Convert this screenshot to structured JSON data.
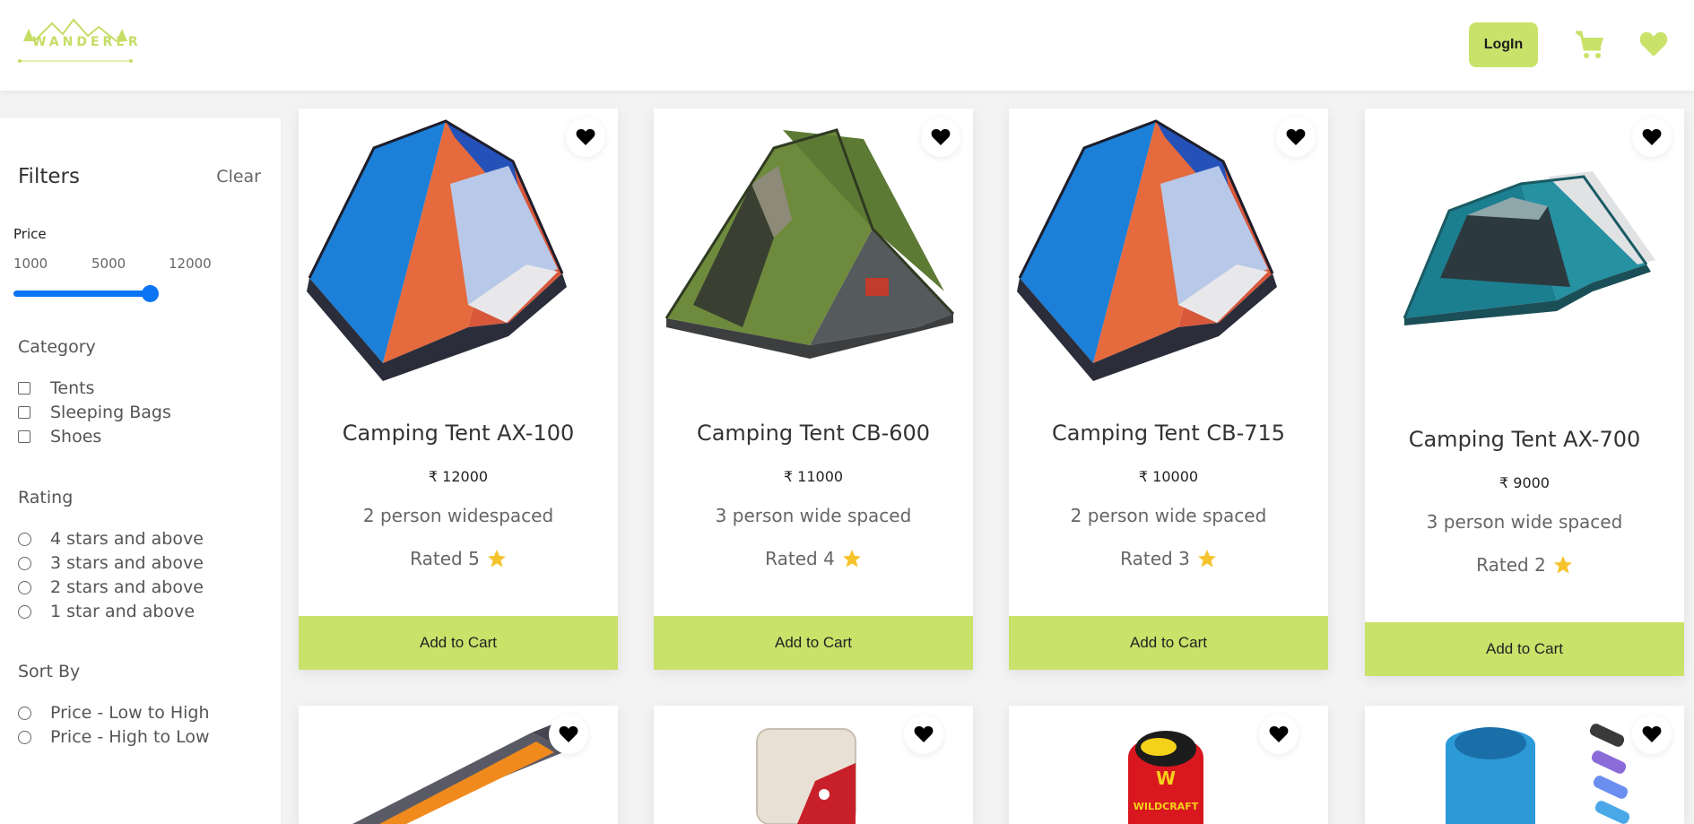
{
  "brand": {
    "name": "WANDERER"
  },
  "header": {
    "login_label": "LogIn",
    "cart_icon": "cart-icon",
    "wishlist_icon": "heart-icon"
  },
  "colors": {
    "accent": "#c9e26a",
    "slider": "#0b74f5",
    "star": "#f5c32c"
  },
  "filters": {
    "title": "Filters",
    "clear_label": "Clear",
    "price": {
      "label": "Price",
      "ticks": [
        "1000",
        "5000",
        "12000"
      ],
      "min": 1000,
      "max": 12000,
      "value": 12000
    },
    "category": {
      "title": "Category",
      "options": [
        {
          "label": "Tents",
          "checked": false
        },
        {
          "label": "Sleeping Bags",
          "checked": false
        },
        {
          "label": "Shoes",
          "checked": false
        }
      ]
    },
    "rating": {
      "title": "Rating",
      "options": [
        {
          "label": "4 stars and above"
        },
        {
          "label": "3 stars and above"
        },
        {
          "label": "2 stars and above"
        },
        {
          "label": "1 star and above"
        }
      ]
    },
    "sort": {
      "title": "Sort By",
      "options": [
        {
          "label": "Price - Low to High"
        },
        {
          "label": "Price - High to Low"
        }
      ]
    }
  },
  "products": [
    {
      "name": "Camping Tent AX-100",
      "price": "₹ 12000",
      "desc": "2 person widespaced",
      "rating": "Rated 5",
      "button": "Add to Cart",
      "image": "dome-tent-blue-orange"
    },
    {
      "name": "Camping Tent CB-600",
      "price": "₹ 11000",
      "desc": "3 person wide spaced",
      "rating": "Rated 4",
      "button": "Add to Cart",
      "image": "tunnel-tent-green"
    },
    {
      "name": "Camping Tent CB-715",
      "price": "₹ 10000",
      "desc": "2 person wide spaced",
      "rating": "Rated 3",
      "button": "Add to Cart",
      "image": "dome-tent-blue-orange"
    },
    {
      "name": "Camping Tent AX-700",
      "price": "₹ 9000",
      "desc": "3 person wide spaced",
      "rating": "Rated 2",
      "button": "Add to Cart",
      "image": "dome-tent-teal"
    }
  ],
  "products_row2": [
    {
      "image": "sleeping-bag-orange"
    },
    {
      "image": "sleeping-bag-red-beige"
    },
    {
      "image": "sleeping-bag-red-wildcraft",
      "brand_text": "WILDCRAFT"
    },
    {
      "image": "sleeping-bag-blue"
    }
  ]
}
